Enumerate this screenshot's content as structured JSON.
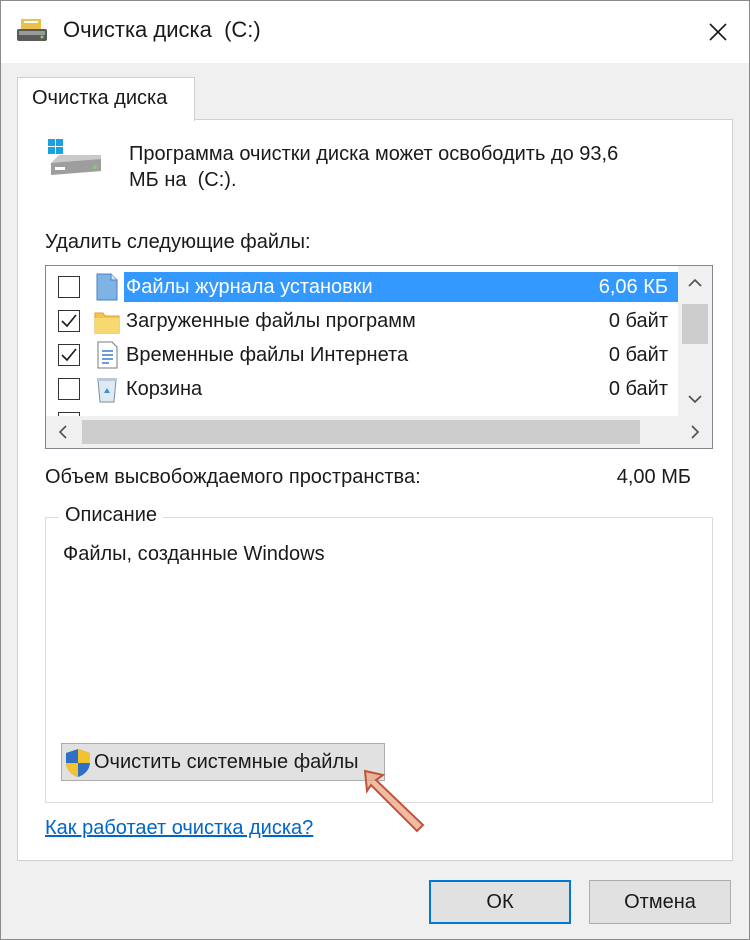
{
  "window": {
    "title": "Очистка диска  (C:)",
    "title_icon": "disk-cleanup-icon",
    "close_icon": "close-icon"
  },
  "tab": {
    "label": "Очистка диска"
  },
  "intro": {
    "icon": "hard-drive-icon",
    "line1": "Программа очистки диска может освободить до 93,6",
    "line2": "МБ на  (C:)."
  },
  "files": {
    "label": "Удалить следующие файлы:",
    "items": [
      {
        "name": "Файлы журнала установки",
        "size": "6,06 КБ",
        "checked": false,
        "selected": true,
        "icon": "log-file-icon"
      },
      {
        "name": "Загруженные файлы программ",
        "size": "0 байт",
        "checked": true,
        "selected": false,
        "icon": "folder-icon"
      },
      {
        "name": "Временные файлы Интернета",
        "size": "0 байт",
        "checked": true,
        "selected": false,
        "icon": "document-icon"
      },
      {
        "name": "Корзина",
        "size": "0 байт",
        "checked": false,
        "selected": false,
        "icon": "recycle-bin-icon"
      }
    ]
  },
  "space": {
    "label": "Объем высвобождаемого пространства:",
    "value": "4,00 МБ"
  },
  "description": {
    "legend": "Описание",
    "text": "Файлы, созданные Windows"
  },
  "clean_button": {
    "label": "Очистить системные файлы",
    "icon": "uac-shield-icon"
  },
  "help_link": "Как работает очистка диска?",
  "buttons": {
    "ok": "ОК",
    "cancel": "Отмена"
  },
  "colors": {
    "selection": "#3399ff",
    "link": "#0066cc",
    "default_button_border": "#0078d7"
  }
}
